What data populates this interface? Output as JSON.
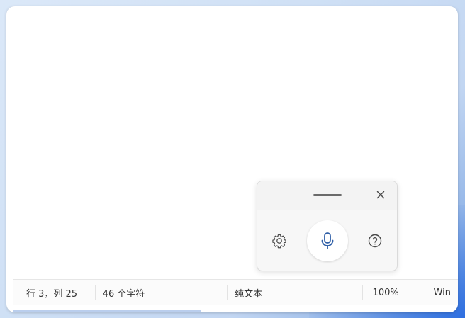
{
  "statusbar": {
    "position": "行 3，列 25",
    "char_count": "46 个字符",
    "encoding": "纯文本",
    "zoom": "100%",
    "line_ending": "Win"
  },
  "voice_panel": {
    "icons": {
      "drag": "drag-handle",
      "close": "close-icon",
      "settings": "gear-icon",
      "microphone": "microphone-icon",
      "help": "question-icon"
    },
    "accent_color": "#2f5fa7"
  }
}
